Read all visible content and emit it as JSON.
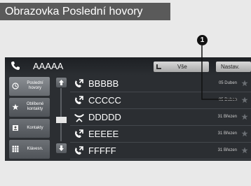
{
  "caption": "Obrazovka Poslední hovory",
  "callout_number": "1",
  "topbar": {
    "contact_name": "AAAAA",
    "all_button": "Vše",
    "settings_button": "Nastav."
  },
  "sidebar": {
    "items": [
      {
        "label": "Poslední hovory",
        "icon": "clock-icon"
      },
      {
        "label": "Oblíbené kontakty",
        "icon": "star-icon"
      },
      {
        "label": "Kontakty",
        "icon": "contacts-icon"
      },
      {
        "label": "Klávesn.",
        "icon": "keypad-icon"
      }
    ]
  },
  "calls": [
    {
      "name": "BBBBB",
      "date": "05 Duben",
      "type": "outgoing"
    },
    {
      "name": "CCCCC",
      "date": "05 Duben",
      "type": "outgoing"
    },
    {
      "name": "DDDDD",
      "date": "31 Březen",
      "type": "missed"
    },
    {
      "name": "EEEEE",
      "date": "31 Březen",
      "type": "outgoing"
    },
    {
      "name": "FFFFF",
      "date": "31 Březen",
      "type": "outgoing"
    }
  ],
  "colors": {
    "screen_bg": "#2b2e32",
    "caption_bg": "#5a5a5a"
  }
}
